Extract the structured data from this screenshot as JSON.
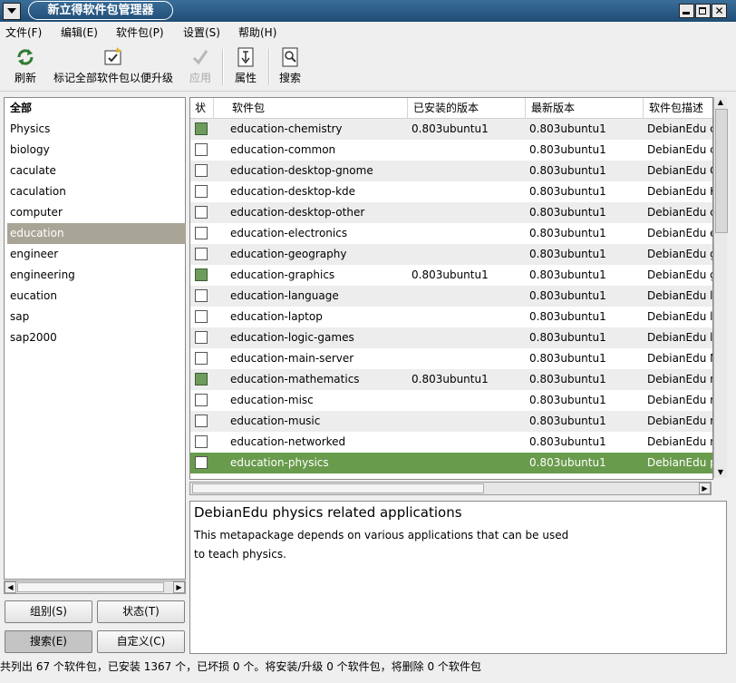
{
  "window": {
    "title": "新立得软件包管理器"
  },
  "menubar": [
    "文件(F)",
    "编辑(E)",
    "软件包(P)",
    "设置(S)",
    "帮助(H)"
  ],
  "toolbar": {
    "refresh": "刷新",
    "mark_all": "标记全部软件包以便升级",
    "apply": "应用",
    "properties": "属性",
    "search": "搜索"
  },
  "categories": {
    "items": [
      "全部",
      "Physics",
      "biology",
      "caculate",
      "caculation",
      "computer",
      "education",
      "engineer",
      "engineering",
      "eucation",
      "sap",
      "sap2000"
    ],
    "selected": "education"
  },
  "filter_buttons": {
    "group": "组别(S)",
    "status": "状态(T)",
    "search": "搜索(E)",
    "custom": "自定义(C)"
  },
  "package_table": {
    "columns": [
      "状",
      "软件包",
      "已安装的版本",
      "最新版本",
      "软件包描述"
    ],
    "rows": [
      {
        "installed": true,
        "name": "education-chemistry",
        "installed_version": "0.803ubuntu1",
        "latest_version": "0.803ubuntu1",
        "desc": "DebianEdu c"
      },
      {
        "installed": false,
        "name": "education-common",
        "installed_version": "",
        "latest_version": "0.803ubuntu1",
        "desc": "DebianEdu c"
      },
      {
        "installed": false,
        "name": "education-desktop-gnome",
        "installed_version": "",
        "latest_version": "0.803ubuntu1",
        "desc": "DebianEdu G"
      },
      {
        "installed": false,
        "name": "education-desktop-kde",
        "installed_version": "",
        "latest_version": "0.803ubuntu1",
        "desc": "DebianEdu K"
      },
      {
        "installed": false,
        "name": "education-desktop-other",
        "installed_version": "",
        "latest_version": "0.803ubuntu1",
        "desc": "DebianEdu c"
      },
      {
        "installed": false,
        "name": "education-electronics",
        "installed_version": "",
        "latest_version": "0.803ubuntu1",
        "desc": "DebianEdu e"
      },
      {
        "installed": false,
        "name": "education-geography",
        "installed_version": "",
        "latest_version": "0.803ubuntu1",
        "desc": "DebianEdu g"
      },
      {
        "installed": true,
        "name": "education-graphics",
        "installed_version": "0.803ubuntu1",
        "latest_version": "0.803ubuntu1",
        "desc": "DebianEdu g"
      },
      {
        "installed": false,
        "name": "education-language",
        "installed_version": "",
        "latest_version": "0.803ubuntu1",
        "desc": "DebianEdu la"
      },
      {
        "installed": false,
        "name": "education-laptop",
        "installed_version": "",
        "latest_version": "0.803ubuntu1",
        "desc": "DebianEdu la"
      },
      {
        "installed": false,
        "name": "education-logic-games",
        "installed_version": "",
        "latest_version": "0.803ubuntu1",
        "desc": "DebianEdu lc"
      },
      {
        "installed": false,
        "name": "education-main-server",
        "installed_version": "",
        "latest_version": "0.803ubuntu1",
        "desc": "DebianEdu M"
      },
      {
        "installed": true,
        "name": "education-mathematics",
        "installed_version": "0.803ubuntu1",
        "latest_version": "0.803ubuntu1",
        "desc": "DebianEdu m"
      },
      {
        "installed": false,
        "name": "education-misc",
        "installed_version": "",
        "latest_version": "0.803ubuntu1",
        "desc": "DebianEdu m"
      },
      {
        "installed": false,
        "name": "education-music",
        "installed_version": "",
        "latest_version": "0.803ubuntu1",
        "desc": "DebianEdu m"
      },
      {
        "installed": false,
        "name": "education-networked",
        "installed_version": "",
        "latest_version": "0.803ubuntu1",
        "desc": "DebianEdu n"
      },
      {
        "installed": false,
        "name": "education-physics",
        "installed_version": "",
        "latest_version": "0.803ubuntu1",
        "desc": "DebianEdu p"
      }
    ],
    "selected": "education-physics"
  },
  "description": {
    "title": "DebianEdu physics related applications",
    "body": "This metapackage depends on various applications that can be used to teach physics."
  },
  "statusbar": "共列出 67 个软件包，已安装 1367 个，已坏损 0 个。将安装/升级 0 个软件包，将删除 0 个软件包",
  "colors": {
    "titlebar": "#2a5a85",
    "selection_category": "#a9a596",
    "selection_row": "#699b4c",
    "installed_box": "#6d9c5c"
  }
}
